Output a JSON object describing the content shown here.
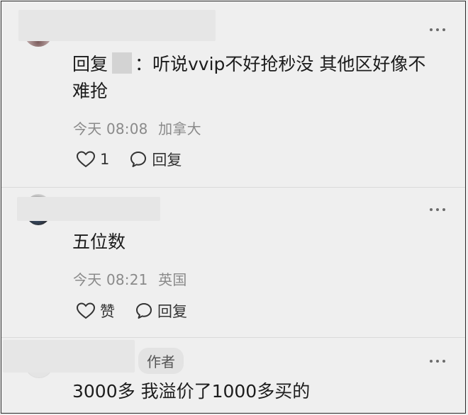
{
  "comments": [
    {
      "reply_prefix": "回复",
      "reply_text": "：听说vvip不好抢秒没 其他区好像不难抢",
      "time": "今天 08:08",
      "location": "加拿大",
      "like_count": "1",
      "reply_label": "回复"
    },
    {
      "text": "五位数",
      "time": "今天 08:21",
      "location": "英国",
      "like_label": "赞",
      "reply_label": "回复"
    },
    {
      "author_badge": "作者",
      "text": "3000多 我溢价了1000多买的"
    }
  ],
  "icons": [
    "more-icon",
    "heart-icon",
    "comment-bubble-icon"
  ],
  "colors": {
    "background": "#efefef",
    "meta": "#8a8a8a",
    "text": "#1c1c1c"
  }
}
